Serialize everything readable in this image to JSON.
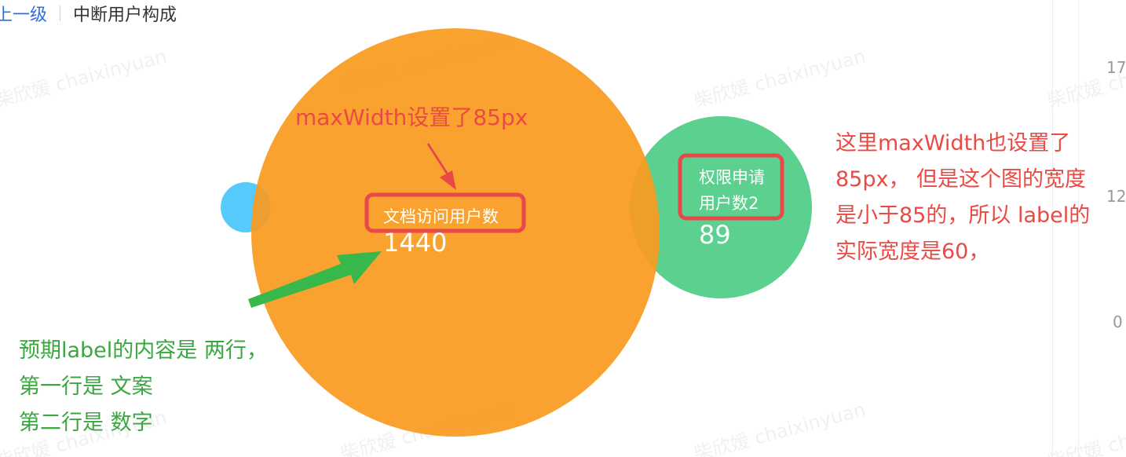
{
  "header": {
    "back_label": "上一级",
    "title": "中断用户构成"
  },
  "watermark_text": "柴欣媛 chaixinyuan",
  "axis_ticks": [
    "17",
    "12",
    "0"
  ],
  "chart_data": {
    "type": "bubble",
    "title": "",
    "series": [
      {
        "label_lines": [],
        "value": null,
        "color": "#56cbfb"
      },
      {
        "label_lines": [
          "文档访问用户数"
        ],
        "value": 1440,
        "value_text": "1440",
        "color": "#fa9a1e"
      },
      {
        "label_lines": [
          "权限申请",
          "用户数2"
        ],
        "value": 89,
        "value_text": "89",
        "color": "#5bd08f"
      }
    ]
  },
  "annotations": {
    "top": "maxWidth设置了85px",
    "right_lines": [
      "这里maxWidth也设置了",
      "85px， 但是这个图的宽度",
      "是小于85的，所以 label的",
      "实际宽度是60，"
    ],
    "left_lines": [
      "预期label的内容是 两行，",
      "第一行是 文案",
      "第二行是 数字"
    ]
  },
  "colors": {
    "annotation_red": "#ea4a44",
    "annotation_green": "#3aa740",
    "box_red": "#e84848",
    "arrow_green": "#38b84a"
  }
}
